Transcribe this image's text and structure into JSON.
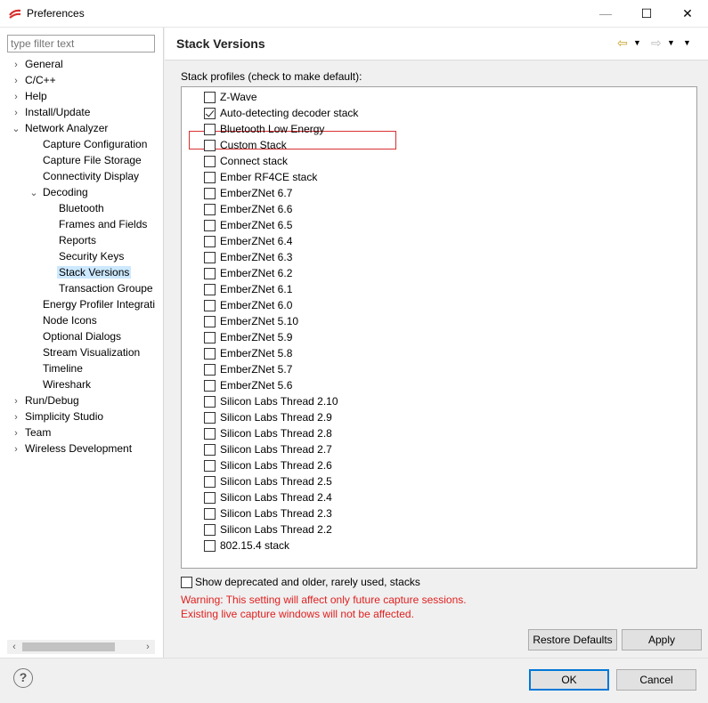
{
  "window": {
    "title": "Preferences"
  },
  "filter": {
    "placeholder": "type filter text"
  },
  "tree": [
    {
      "label": "General",
      "level": 0,
      "chevron": "›"
    },
    {
      "label": "C/C++",
      "level": 0,
      "chevron": "›"
    },
    {
      "label": "Help",
      "level": 0,
      "chevron": "›"
    },
    {
      "label": "Install/Update",
      "level": 0,
      "chevron": "›"
    },
    {
      "label": "Network Analyzer",
      "level": 0,
      "chevron": "⌄"
    },
    {
      "label": "Capture Configuration",
      "level": 1,
      "chevron": ""
    },
    {
      "label": "Capture File Storage",
      "level": 1,
      "chevron": ""
    },
    {
      "label": "Connectivity Display",
      "level": 1,
      "chevron": ""
    },
    {
      "label": "Decoding",
      "level": 1,
      "chevron": "⌄"
    },
    {
      "label": "Bluetooth",
      "level": 2,
      "chevron": ""
    },
    {
      "label": "Frames and Fields",
      "level": 2,
      "chevron": ""
    },
    {
      "label": "Reports",
      "level": 2,
      "chevron": ""
    },
    {
      "label": "Security Keys",
      "level": 2,
      "chevron": ""
    },
    {
      "label": "Stack Versions",
      "level": 2,
      "chevron": "",
      "selected": true
    },
    {
      "label": "Transaction Groupe",
      "level": 2,
      "chevron": ""
    },
    {
      "label": "Energy Profiler Integrati",
      "level": 1,
      "chevron": ""
    },
    {
      "label": "Node Icons",
      "level": 1,
      "chevron": ""
    },
    {
      "label": "Optional Dialogs",
      "level": 1,
      "chevron": ""
    },
    {
      "label": "Stream Visualization",
      "level": 1,
      "chevron": ""
    },
    {
      "label": "Timeline",
      "level": 1,
      "chevron": ""
    },
    {
      "label": "Wireshark",
      "level": 1,
      "chevron": ""
    },
    {
      "label": "Run/Debug",
      "level": 0,
      "chevron": "›"
    },
    {
      "label": "Simplicity Studio",
      "level": 0,
      "chevron": "›"
    },
    {
      "label": "Team",
      "level": 0,
      "chevron": "›"
    },
    {
      "label": "Wireless Development",
      "level": 0,
      "chevron": "›"
    }
  ],
  "page": {
    "title": "Stack Versions",
    "stack_label": "Stack profiles (check to make default):",
    "stacks": [
      {
        "label": "Z-Wave",
        "checked": false
      },
      {
        "label": "Auto-detecting decoder stack",
        "checked": true
      },
      {
        "label": "Bluetooth Low Energy",
        "checked": false
      },
      {
        "label": "Custom Stack",
        "checked": false
      },
      {
        "label": "Connect stack",
        "checked": false
      },
      {
        "label": "Ember RF4CE stack",
        "checked": false
      },
      {
        "label": "EmberZNet 6.7",
        "checked": false
      },
      {
        "label": "EmberZNet 6.6",
        "checked": false
      },
      {
        "label": "EmberZNet 6.5",
        "checked": false
      },
      {
        "label": "EmberZNet 6.4",
        "checked": false
      },
      {
        "label": "EmberZNet 6.3",
        "checked": false
      },
      {
        "label": "EmberZNet 6.2",
        "checked": false
      },
      {
        "label": "EmberZNet 6.1",
        "checked": false
      },
      {
        "label": "EmberZNet 6.0",
        "checked": false
      },
      {
        "label": "EmberZNet 5.10",
        "checked": false
      },
      {
        "label": "EmberZNet 5.9",
        "checked": false
      },
      {
        "label": "EmberZNet 5.8",
        "checked": false
      },
      {
        "label": "EmberZNet 5.7",
        "checked": false
      },
      {
        "label": "EmberZNet 5.6",
        "checked": false
      },
      {
        "label": "Silicon Labs Thread 2.10",
        "checked": false
      },
      {
        "label": "Silicon Labs Thread 2.9",
        "checked": false
      },
      {
        "label": "Silicon Labs Thread 2.8",
        "checked": false
      },
      {
        "label": "Silicon Labs Thread 2.7",
        "checked": false
      },
      {
        "label": "Silicon Labs Thread 2.6",
        "checked": false
      },
      {
        "label": "Silicon Labs Thread 2.5",
        "checked": false
      },
      {
        "label": "Silicon Labs Thread 2.4",
        "checked": false
      },
      {
        "label": "Silicon Labs Thread 2.3",
        "checked": false
      },
      {
        "label": "Silicon Labs Thread 2.2",
        "checked": false
      },
      {
        "label": "802.15.4 stack",
        "checked": false
      }
    ],
    "deprecated_label": "Show deprecated and older, rarely used, stacks",
    "warning_1": "Warning: This setting will affect only future capture sessions.",
    "warning_2": "Existing live capture windows will not be affected.",
    "restore_label": "Restore Defaults",
    "apply_label": "Apply"
  },
  "footer": {
    "ok_label": "OK",
    "cancel_label": "Cancel",
    "help_glyph": "?"
  },
  "colors": {
    "accent": "#0078d7",
    "warning": "#e02020",
    "selection": "#cce8ff",
    "highlight_border": "#d83030"
  }
}
